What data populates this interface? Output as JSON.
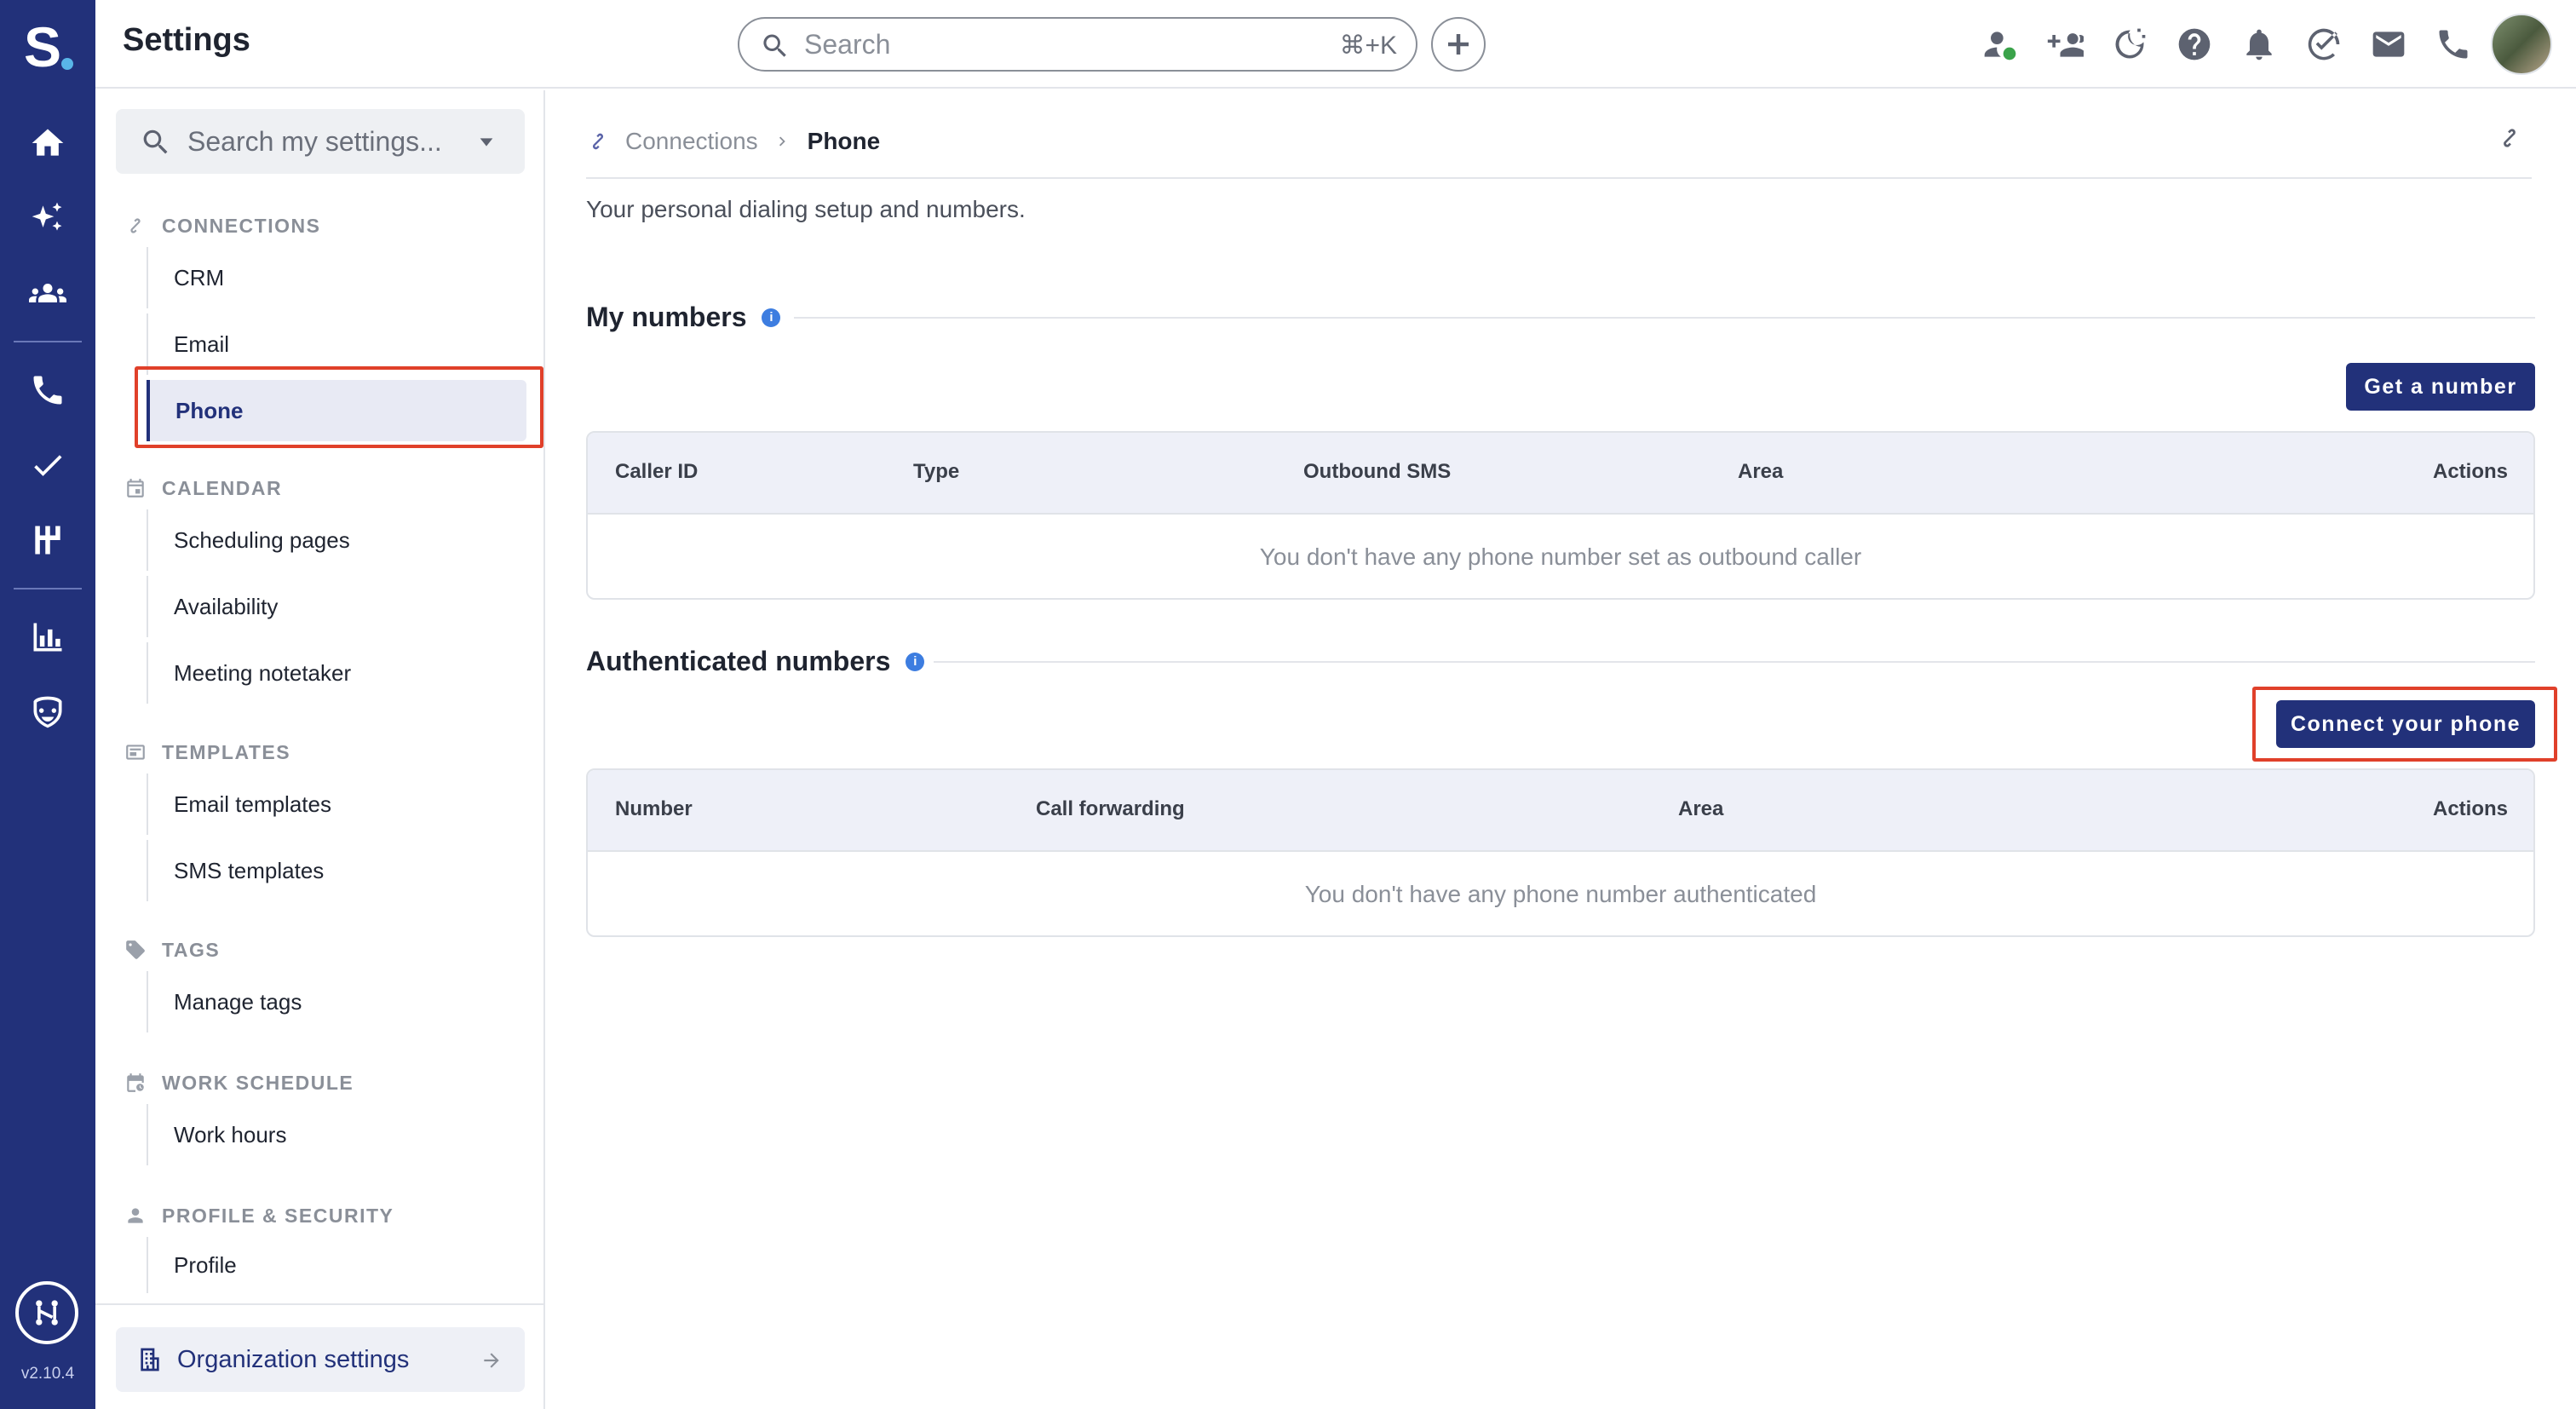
{
  "rail": {
    "logo_letter": "S",
    "version": "v2.10.4",
    "items": [
      "home-icon",
      "sparkles-icon",
      "team-icon",
      "phone-icon",
      "check-icon",
      "dialer-icon",
      "bar-chart-icon",
      "mask-icon"
    ]
  },
  "header": {
    "title": "Settings",
    "search_placeholder": "Search",
    "search_shortcut": "⌘+K",
    "icons": [
      "user-status-icon",
      "add-team-icon",
      "do-not-disturb-icon",
      "help-icon",
      "bell-icon",
      "tasks-icon",
      "mail-icon",
      "phone-icon",
      "avatar"
    ]
  },
  "sidebar": {
    "search_placeholder": "Search my settings...",
    "sections": [
      {
        "title": "CONNECTIONS",
        "items": [
          "CRM",
          "Email",
          "Phone"
        ]
      },
      {
        "title": "CALENDAR",
        "items": [
          "Scheduling pages",
          "Availability",
          "Meeting notetaker"
        ]
      },
      {
        "title": "TEMPLATES",
        "items": [
          "Email templates",
          "SMS templates"
        ]
      },
      {
        "title": "TAGS",
        "items": [
          "Manage tags"
        ]
      },
      {
        "title": "WORK SCHEDULE",
        "items": [
          "Work hours"
        ]
      },
      {
        "title": "PROFILE & SECURITY",
        "items": [
          "Profile"
        ]
      }
    ],
    "active_item": "Phone",
    "org_settings_label": "Organization settings"
  },
  "main": {
    "breadcrumb": {
      "parent": "Connections",
      "current": "Phone"
    },
    "description": "Your personal dialing setup and numbers.",
    "my_numbers": {
      "title": "My numbers",
      "button": "Get a number",
      "columns": [
        "Caller ID",
        "Type",
        "Outbound SMS",
        "Area",
        "Actions"
      ],
      "empty": "You don't have any phone number set as outbound caller"
    },
    "authenticated_numbers": {
      "title": "Authenticated numbers",
      "button": "Connect your phone",
      "columns": [
        "Number",
        "Call forwarding",
        "Area",
        "Actions"
      ],
      "empty": "You don't have any phone number authenticated"
    }
  },
  "colors": {
    "rail_bg": "#22317a",
    "accent": "#22317a",
    "highlight_box": "#e0402a",
    "info_dot": "#3d7de0"
  }
}
